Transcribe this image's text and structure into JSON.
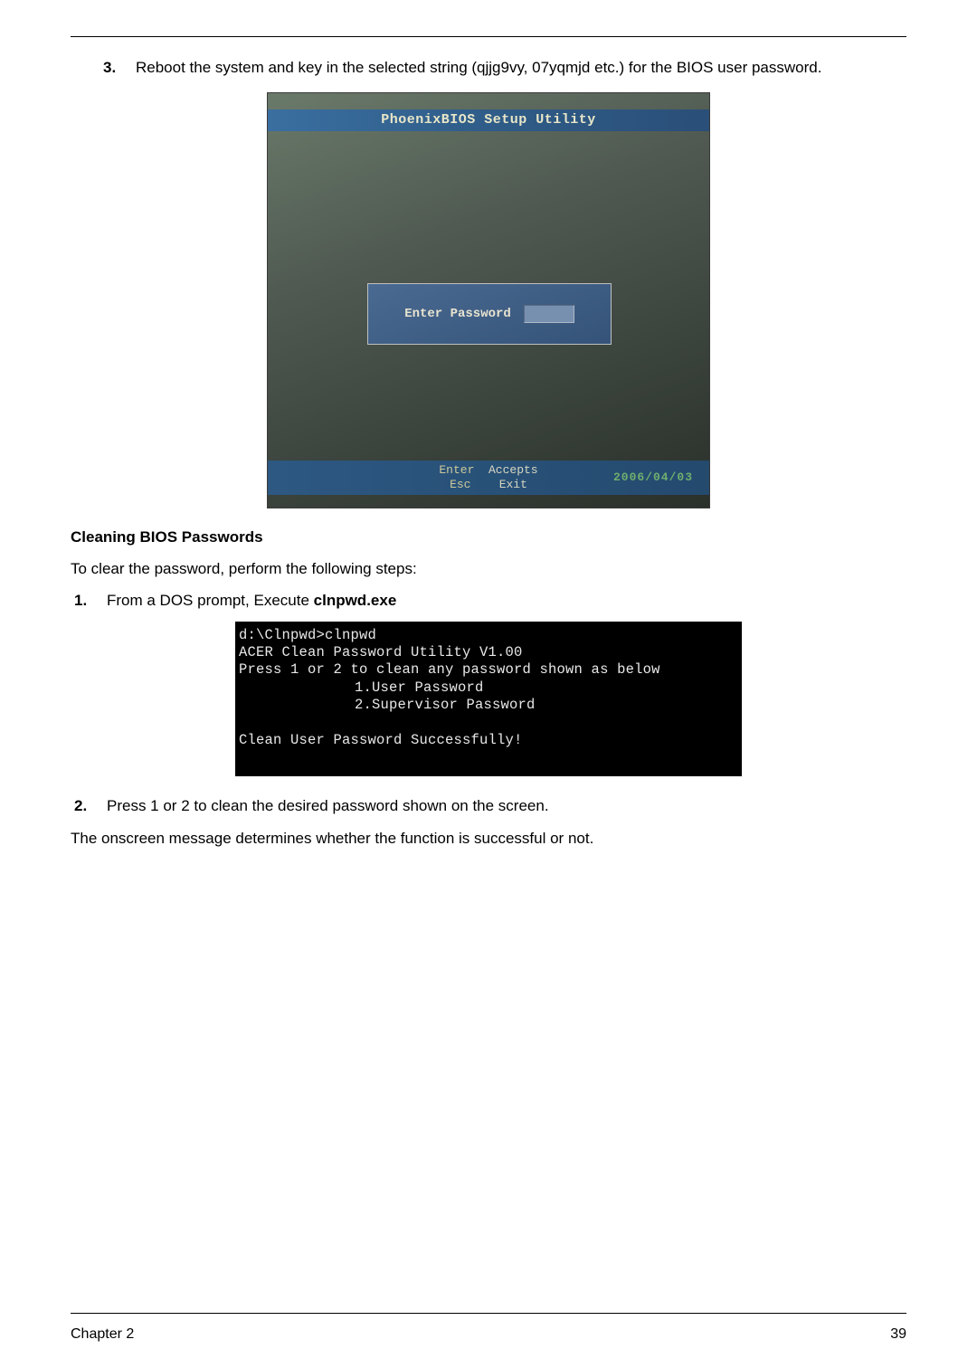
{
  "step3": {
    "num": "3.",
    "text": "Reboot the system and key in the selected string (qjjg9vy, 07yqmjd etc.) for the BIOS user password."
  },
  "bios": {
    "title": "PhoenixBIOS Setup Utility",
    "enter_label": "Enter Password",
    "key_enter_k": "Enter",
    "key_enter_v": "Accepts",
    "key_esc_k": "Esc",
    "key_esc_v": "Exit",
    "date": "2006/04/03"
  },
  "section_heading": "Cleaning BIOS Passwords",
  "intro": "To clear the password, perform the following steps:",
  "sub1": {
    "num": "1.",
    "prefix": "From a DOS prompt, Execute ",
    "bold": "clnpwd.exe"
  },
  "dos": {
    "l1": "d:\\Clnpwd>clnpwd",
    "l2": "ACER Clean Password Utility V1.00",
    "l3": "Press 1 or 2 to clean any password shown as below",
    "l4": "1.User Password",
    "l5": "2.Supervisor Password",
    "l6": "Clean User Password Successfully!"
  },
  "sub2": {
    "num": "2.",
    "text": "Press 1 or 2 to clean the desired password shown on the screen."
  },
  "closing": "The onscreen message determines whether the function is successful or not.",
  "footer": {
    "left": "Chapter 2",
    "right": "39"
  }
}
